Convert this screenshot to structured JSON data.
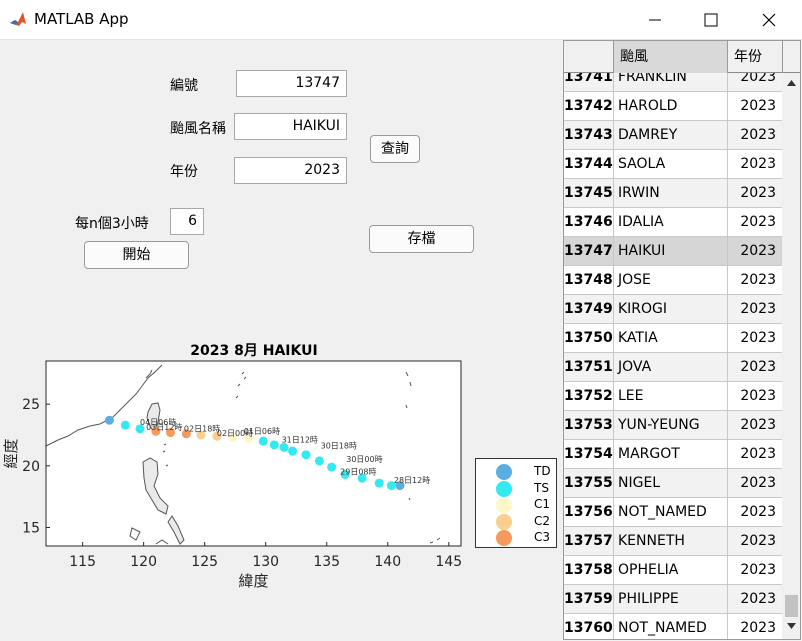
{
  "window": {
    "title": "MATLAB App",
    "icon": "matlab-icon",
    "controls": [
      "minimize-icon",
      "maximize-icon",
      "close-icon"
    ]
  },
  "form": {
    "id_label": "編號",
    "id_value": "13747",
    "name_label": "颱風名稱",
    "name_value": "HAIKUI",
    "year_label": "年份",
    "year_value": "2023",
    "query_button": "查詢",
    "interval_label": "每n個3小時",
    "interval_value": "6",
    "start_button": "開始",
    "save_button": "存檔"
  },
  "table": {
    "headers": [
      "",
      "颱風",
      "年份"
    ],
    "rows": [
      {
        "id": "13741",
        "name": "FRANKLIN",
        "year": "2023"
      },
      {
        "id": "13742",
        "name": "HAROLD",
        "year": "2023"
      },
      {
        "id": "13743",
        "name": "DAMREY",
        "year": "2023"
      },
      {
        "id": "13744",
        "name": "SAOLA",
        "year": "2023"
      },
      {
        "id": "13745",
        "name": "IRWIN",
        "year": "2023"
      },
      {
        "id": "13746",
        "name": "IDALIA",
        "year": "2023"
      },
      {
        "id": "13747",
        "name": "HAIKUI",
        "year": "2023"
      },
      {
        "id": "13748",
        "name": "JOSE",
        "year": "2023"
      },
      {
        "id": "13749",
        "name": "KIROGI",
        "year": "2023"
      },
      {
        "id": "13750",
        "name": "KATIA",
        "year": "2023"
      },
      {
        "id": "13751",
        "name": "JOVA",
        "year": "2023"
      },
      {
        "id": "13752",
        "name": "LEE",
        "year": "2023"
      },
      {
        "id": "13753",
        "name": "YUN-YEUNG",
        "year": "2023"
      },
      {
        "id": "13754",
        "name": "MARGOT",
        "year": "2023"
      },
      {
        "id": "13755",
        "name": "NIGEL",
        "year": "2023"
      },
      {
        "id": "13756",
        "name": "NOT_NAMED",
        "year": "2023"
      },
      {
        "id": "13757",
        "name": "KENNETH",
        "year": "2023"
      },
      {
        "id": "13758",
        "name": "OPHELIA",
        "year": "2023"
      },
      {
        "id": "13759",
        "name": "PHILIPPE",
        "year": "2023"
      },
      {
        "id": "13760",
        "name": "NOT_NAMED",
        "year": "2023"
      }
    ],
    "selected_id": "13747"
  },
  "chart_data": {
    "type": "scatter",
    "title": "2023 8月 HAIKUI",
    "xlabel": "緯度",
    "ylabel": "經度",
    "xlim": [
      112,
      146
    ],
    "ylim": [
      13.5,
      28.5
    ],
    "xticks": [
      115,
      120,
      125,
      130,
      135,
      140,
      145
    ],
    "yticks": [
      15,
      20,
      25
    ],
    "legend": {
      "placement": "right",
      "entries": [
        {
          "label": "TD",
          "color": "#5aaee0"
        },
        {
          "label": "TS",
          "color": "#33eaf0"
        },
        {
          "label": "C1",
          "color": "#fdf6c8"
        },
        {
          "label": "C2",
          "color": "#f8cf8c"
        },
        {
          "label": "C3",
          "color": "#f59a5c"
        }
      ]
    },
    "track": [
      {
        "x": 141.0,
        "y": 18.4,
        "cat": "TD"
      },
      {
        "x": 140.3,
        "y": 18.4,
        "cat": "TS"
      },
      {
        "x": 139.3,
        "y": 18.6,
        "cat": "TS"
      },
      {
        "x": 137.9,
        "y": 19.0,
        "cat": "TS"
      },
      {
        "x": 136.5,
        "y": 19.3,
        "cat": "TS"
      },
      {
        "x": 135.4,
        "y": 19.9,
        "cat": "TS"
      },
      {
        "x": 134.4,
        "y": 20.4,
        "cat": "TS"
      },
      {
        "x": 133.3,
        "y": 20.9,
        "cat": "TS"
      },
      {
        "x": 132.2,
        "y": 21.2,
        "cat": "TS"
      },
      {
        "x": 131.5,
        "y": 21.5,
        "cat": "TS"
      },
      {
        "x": 130.7,
        "y": 21.7,
        "cat": "TS"
      },
      {
        "x": 129.8,
        "y": 22.0,
        "cat": "TS"
      },
      {
        "x": 128.6,
        "y": 22.2,
        "cat": "C1"
      },
      {
        "x": 127.3,
        "y": 22.3,
        "cat": "C1"
      },
      {
        "x": 126.0,
        "y": 22.4,
        "cat": "C2"
      },
      {
        "x": 124.7,
        "y": 22.5,
        "cat": "C2"
      },
      {
        "x": 123.5,
        "y": 22.6,
        "cat": "C3"
      },
      {
        "x": 122.2,
        "y": 22.7,
        "cat": "C3"
      },
      {
        "x": 121.0,
        "y": 22.8,
        "cat": "C3"
      },
      {
        "x": 119.7,
        "y": 23.0,
        "cat": "TS"
      },
      {
        "x": 118.5,
        "y": 23.3,
        "cat": "TS"
      },
      {
        "x": 117.2,
        "y": 23.7,
        "cat": "TD"
      }
    ],
    "annotations": [
      {
        "x": 140.5,
        "y": 18.6,
        "text": "28日12時"
      },
      {
        "x": 136.1,
        "y": 19.3,
        "text": "29日08時"
      },
      {
        "x": 136.6,
        "y": 20.3,
        "text": "30日00時"
      },
      {
        "x": 134.5,
        "y": 21.4,
        "text": "30日18時"
      },
      {
        "x": 131.3,
        "y": 21.9,
        "text": "31日12時"
      },
      {
        "x": 128.2,
        "y": 22.6,
        "text": "01日06時"
      },
      {
        "x": 126.0,
        "y": 22.4,
        "text": "02日00時"
      },
      {
        "x": 123.3,
        "y": 22.8,
        "text": "02日18時"
      },
      {
        "x": 120.2,
        "y": 22.9,
        "text": "03日12時"
      },
      {
        "x": 119.7,
        "y": 23.3,
        "text": "04日06時"
      }
    ]
  }
}
